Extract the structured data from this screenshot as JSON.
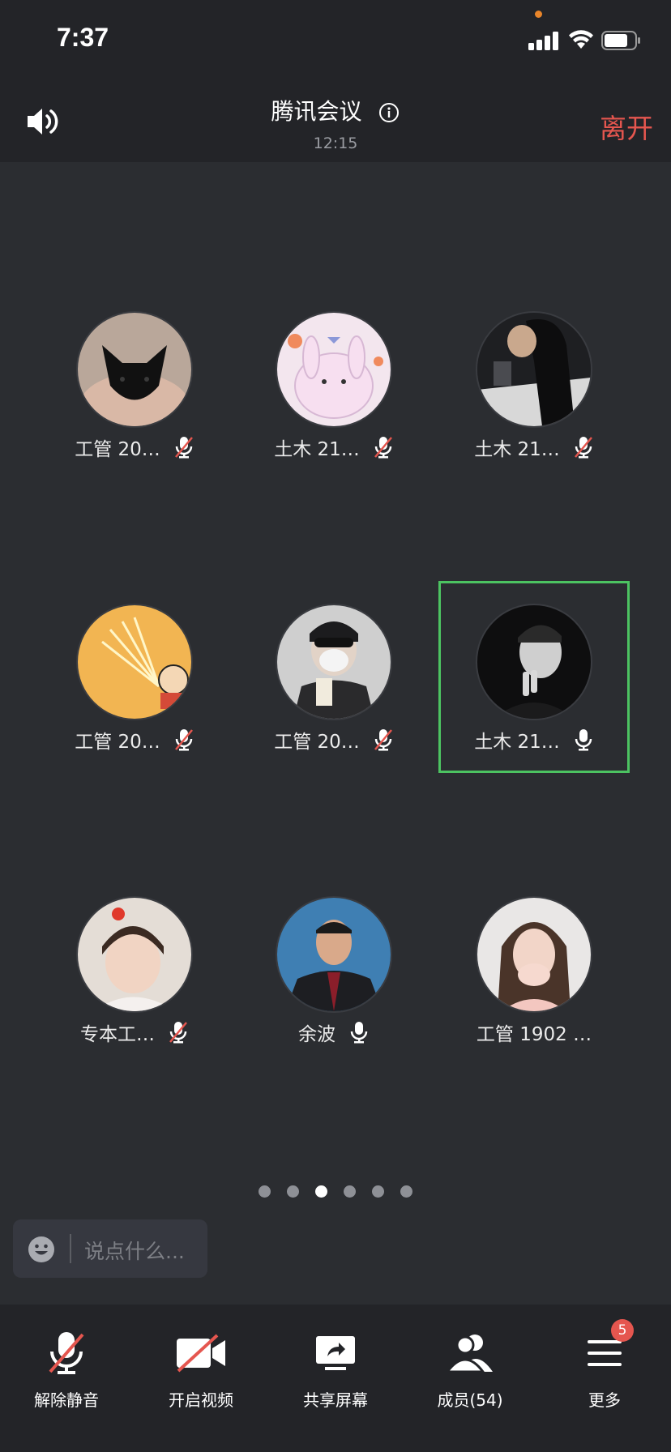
{
  "status_bar": {
    "time": "7:37"
  },
  "header": {
    "title": "腾讯会议",
    "elapsed": "12:15",
    "leave_label": "离开"
  },
  "participants": [
    {
      "name": "工管 20…",
      "mic": "muted"
    },
    {
      "name": "土木 21…",
      "mic": "muted"
    },
    {
      "name": "土木 21…",
      "mic": "muted"
    },
    {
      "name": "工管 20…",
      "mic": "muted"
    },
    {
      "name": "工管 20…",
      "mic": "muted"
    },
    {
      "name": "土木 21…",
      "mic": "on",
      "active_speaker": true
    },
    {
      "name": "专本工…",
      "mic": "muted"
    },
    {
      "name": "余波",
      "mic": "on"
    },
    {
      "name": "工管 1902 …",
      "mic": "none"
    }
  ],
  "pager": {
    "pages": 6,
    "current": 3
  },
  "chat": {
    "placeholder": "说点什么..."
  },
  "toolbar": {
    "unmute_label": "解除静音",
    "video_label": "开启视频",
    "share_label": "共享屏幕",
    "members_label": "成员(54)",
    "more_label": "更多",
    "more_badge": "5"
  },
  "colors": {
    "leave": "#e5564f",
    "active_frame": "#4cc361",
    "background": "#2b2d31"
  }
}
